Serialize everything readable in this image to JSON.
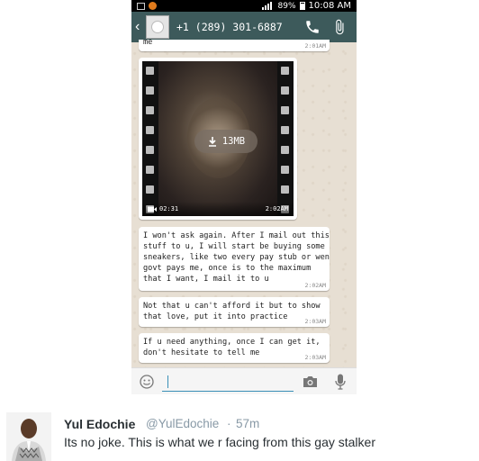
{
  "status_bar": {
    "battery": "89%",
    "time": "10:08 AM"
  },
  "chat_header": {
    "contact": "+1 (289) 301-6887"
  },
  "messages": [
    {
      "text": "me",
      "time": "2:01AM"
    },
    {
      "text": "I won't ask again. After I mail out this\nstuff to u, I will start be buying some\nsneakers, like two every pay stub or wen\ngovt pays me, once is to the maximum\nthat I want, I mail it to u",
      "time": "2:02AM"
    },
    {
      "text": "Not that u can't afford it but to show\nthat love, put it into practice",
      "time": "2:03AM"
    },
    {
      "text": "If u need anything, once I can get it,\ndon't hesitate to tell me",
      "time": "2:03AM"
    }
  ],
  "video_message": {
    "size": "13MB",
    "duration": "02:31",
    "time": "2:02AM"
  },
  "composer": {
    "placeholder": ""
  },
  "tweet": {
    "name": "Yul Edochie",
    "handle": "@YulEdochie",
    "separator": "·",
    "age": "57m",
    "text": "Its no joke. This is what we r facing from this gay stalker"
  },
  "colors": {
    "app_bar": "#3d5a5b",
    "chat_wallpaper": "#e7dfd3",
    "accent": "#3a8fb7"
  }
}
